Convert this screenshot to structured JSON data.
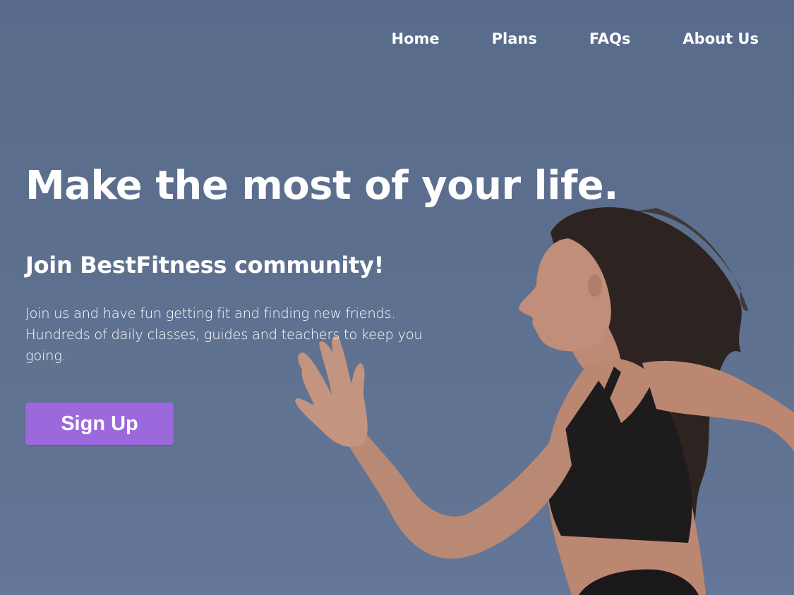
{
  "nav": {
    "items": [
      {
        "label": "Home"
      },
      {
        "label": "Plans"
      },
      {
        "label": "FAQs"
      },
      {
        "label": "About Us"
      }
    ]
  },
  "hero": {
    "headline": "Make the most of your life.",
    "subheadline": "Join BestFitness community!",
    "description": "Join us and have fun getting fit and finding new friends. Hundreds of daily classes, guides and teachers to keep you going.",
    "cta_label": "Sign Up"
  },
  "colors": {
    "sky": "#5d6f8f",
    "cta": "#9c69dc",
    "text": "#ffffff"
  }
}
